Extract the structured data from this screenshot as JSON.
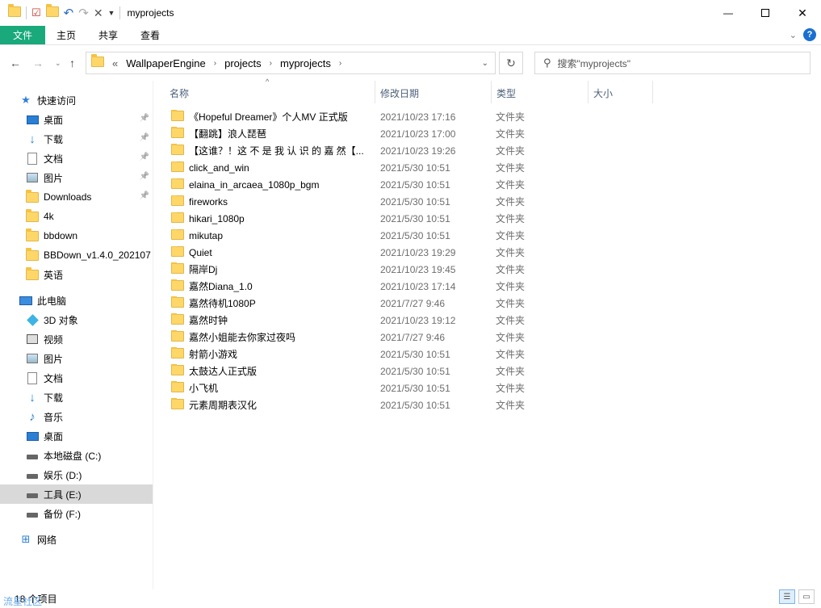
{
  "window": {
    "title": "myprojects",
    "minimize_icon": "minimize-icon",
    "maximize_icon": "maximize-icon",
    "close_icon": "close-icon"
  },
  "ribbon": {
    "tabs": [
      "文件",
      "主页",
      "共享",
      "查看"
    ]
  },
  "address": {
    "prefix": "«",
    "crumbs": [
      "WallpaperEngine",
      "projects",
      "myprojects"
    ]
  },
  "search": {
    "placeholder": "搜索\"myprojects\""
  },
  "sidebar": {
    "items": [
      {
        "label": "快速访问",
        "icon": "star-icon"
      },
      {
        "label": "桌面",
        "icon": "desktop-icon",
        "pinned": true
      },
      {
        "label": "下载",
        "icon": "download-icon",
        "pinned": true
      },
      {
        "label": "文档",
        "icon": "document-icon",
        "pinned": true
      },
      {
        "label": "图片",
        "icon": "picture-icon",
        "pinned": true
      },
      {
        "label": "Downloads",
        "icon": "folder-icon",
        "pinned": true
      },
      {
        "label": "4k",
        "icon": "folder-icon"
      },
      {
        "label": "bbdown",
        "icon": "folder-icon"
      },
      {
        "label": "BBDown_v1.4.0_202107",
        "icon": "folder-icon"
      },
      {
        "label": "英语",
        "icon": "folder-icon"
      },
      {
        "label": "此电脑",
        "icon": "computer-icon"
      },
      {
        "label": "3D 对象",
        "icon": "cube-icon"
      },
      {
        "label": "视频",
        "icon": "video-icon"
      },
      {
        "label": "图片",
        "icon": "picture-icon"
      },
      {
        "label": "文档",
        "icon": "document-icon"
      },
      {
        "label": "下载",
        "icon": "download-icon"
      },
      {
        "label": "音乐",
        "icon": "music-icon"
      },
      {
        "label": "桌面",
        "icon": "desktop-icon"
      },
      {
        "label": "本地磁盘 (C:)",
        "icon": "drive-icon"
      },
      {
        "label": "娱乐 (D:)",
        "icon": "drive-icon"
      },
      {
        "label": "工具 (E:)",
        "icon": "drive-icon",
        "selected": true
      },
      {
        "label": "备份 (F:)",
        "icon": "drive-icon"
      },
      {
        "label": "网络",
        "icon": "network-icon"
      }
    ]
  },
  "columns": [
    "名称",
    "修改日期",
    "类型",
    "大小"
  ],
  "files": [
    {
      "name": "《Hopeful Dreamer》个人MV 正式版",
      "date": "2021/10/23 17:16",
      "type": "文件夹"
    },
    {
      "name": "【翻跳】浪人琵琶",
      "date": "2021/10/23 17:00",
      "type": "文件夹"
    },
    {
      "name": "【这谁？！这 不 是 我 认 识 的 嘉 然【...",
      "date": "2021/10/23 19:26",
      "type": "文件夹"
    },
    {
      "name": "click_and_win",
      "date": "2021/5/30 10:51",
      "type": "文件夹"
    },
    {
      "name": "elaina_in_arcaea_1080p_bgm",
      "date": "2021/5/30 10:51",
      "type": "文件夹"
    },
    {
      "name": "fireworks",
      "date": "2021/5/30 10:51",
      "type": "文件夹"
    },
    {
      "name": "hikari_1080p",
      "date": "2021/5/30 10:51",
      "type": "文件夹"
    },
    {
      "name": "mikutap",
      "date": "2021/5/30 10:51",
      "type": "文件夹"
    },
    {
      "name": "Quiet",
      "date": "2021/10/23 19:29",
      "type": "文件夹"
    },
    {
      "name": "隔岸Dj",
      "date": "2021/10/23 19:45",
      "type": "文件夹"
    },
    {
      "name": "嘉然Diana_1.0",
      "date": "2021/10/23 17:14",
      "type": "文件夹"
    },
    {
      "name": "嘉然待机1080P",
      "date": "2021/7/27 9:46",
      "type": "文件夹"
    },
    {
      "name": "嘉然时钟",
      "date": "2021/10/23 19:12",
      "type": "文件夹"
    },
    {
      "name": "嘉然小姐能去你家过夜吗",
      "date": "2021/7/27 9:46",
      "type": "文件夹"
    },
    {
      "name": "射箭小游戏",
      "date": "2021/5/30 10:51",
      "type": "文件夹"
    },
    {
      "name": "太鼓达人正式版",
      "date": "2021/5/30 10:51",
      "type": "文件夹"
    },
    {
      "name": "小飞机",
      "date": "2021/5/30 10:51",
      "type": "文件夹"
    },
    {
      "name": "元素周期表汉化",
      "date": "2021/5/30 10:51",
      "type": "文件夹"
    }
  ],
  "status": {
    "item_count": "18 个项目",
    "watermark": "流星社区"
  },
  "colors": {
    "file_tab": "#19a97b",
    "selected_nav": "#d9d9d9",
    "folder": "#ffd769"
  }
}
